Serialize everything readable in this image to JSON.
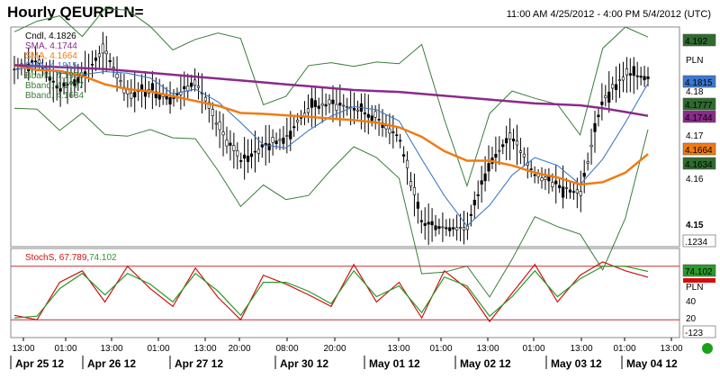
{
  "header": {
    "title": "Hourly QEURPLN=",
    "date_range": "11:00 AM 4/25/2012 - 4:00 PM 5/4/2012 (UTC)"
  },
  "chart_data": [
    {
      "type": "line",
      "name": "price_panel",
      "currency": "PLN",
      "x": [
        "04-25 09:00",
        "04-25 16:00",
        "04-26 00:00",
        "04-26 06:00",
        "04-26 12:00",
        "04-26 18:00",
        "04-27 00:00",
        "04-27 06:00",
        "04-27 12:00",
        "04-27 18:00",
        "04-29 21:00",
        "04-30 00:00",
        "04-30 06:00",
        "04-30 12:00",
        "04-30 18:00",
        "05-01 00:00",
        "05-01 06:00",
        "05-01 12:00",
        "05-01 18:00",
        "05-02 00:00",
        "05-02 06:00",
        "05-02 12:00",
        "05-02 18:00",
        "05-03 00:00",
        "05-03 06:00",
        "05-03 12:00",
        "05-03 18:00",
        "05-04 00:00",
        "05-04 06:00"
      ],
      "close": [
        4.184,
        4.186,
        4.18,
        4.183,
        4.188,
        4.179,
        4.18,
        4.178,
        4.182,
        4.172,
        4.165,
        4.168,
        4.17,
        4.176,
        4.177,
        4.176,
        4.174,
        4.17,
        4.152,
        4.151,
        4.151,
        4.165,
        4.17,
        4.162,
        4.16,
        4.158,
        4.178,
        4.183,
        4.1826
      ],
      "series": [
        {
          "name": "Cndl",
          "value": "4.1826",
          "color": "#000000"
        },
        {
          "name": "SMA",
          "value": "4.1744",
          "color": "#8b2a8b",
          "values": [
            4.185,
            4.1848,
            4.1846,
            4.1844,
            4.1842,
            4.1838,
            4.1834,
            4.183,
            4.1826,
            4.1822,
            4.1818,
            4.1814,
            4.181,
            4.1806,
            4.1802,
            4.1798,
            4.1796,
            4.1794,
            4.179,
            4.1786,
            4.1782,
            4.1778,
            4.1774,
            4.177,
            4.1768,
            4.1766,
            4.176,
            4.1752,
            4.1744
          ]
        },
        {
          "name": "SMA",
          "value": "4.1664",
          "color": "#f07b10",
          "values": [
            4.185,
            4.184,
            4.1838,
            4.1828,
            4.181,
            4.18,
            4.1795,
            4.1785,
            4.1775,
            4.1765,
            4.175,
            4.1748,
            4.1745,
            4.1742,
            4.1738,
            4.1735,
            4.173,
            4.172,
            4.17,
            4.167,
            4.165,
            4.165,
            4.164,
            4.1625,
            4.1615,
            4.16,
            4.1605,
            4.1625,
            4.1664
          ]
        },
        {
          "name": "SMA",
          "value": "4.1815",
          "color": "#3c78d0"
        },
        {
          "name": "Bband",
          "value": "4.1920",
          "color": "#3a7d3a"
        },
        {
          "name": "Bband",
          "value": "4.1777",
          "color": "#3a7d3a"
        },
        {
          "name": "Bband",
          "value": "4.1634",
          "color": "#3a7d3a"
        }
      ],
      "y_ticks": [
        "4.18",
        "4.17",
        "4.16",
        "4.15"
      ],
      "ylim": [
        4.147,
        4.193
      ],
      "tags": [
        {
          "label": "4.192",
          "color": "#2f6b2f"
        },
        {
          "label": "4.1815",
          "color": "#3c78d0"
        },
        {
          "label": "4.1777",
          "color": "#2f6b2f"
        },
        {
          "label": "4.1744",
          "color": "#8b2a8b"
        },
        {
          "label": "4.1664",
          "color": "#f07b10"
        },
        {
          "label": "4.1634",
          "color": "#2f6b2f"
        },
        {
          "label": ".1234",
          "color": "#ffffff"
        }
      ]
    },
    {
      "type": "line",
      "name": "stoch_panel",
      "currency": "PLN",
      "series": [
        {
          "name": "StochS",
          "value": "67.789",
          "color": "#d01010",
          "values": [
            25,
            20,
            62,
            75,
            40,
            80,
            55,
            35,
            78,
            45,
            20,
            70,
            60,
            48,
            35,
            82,
            40,
            62,
            22,
            75,
            55,
            18,
            50,
            82,
            40,
            70,
            85,
            75,
            67.789
          ]
        },
        {
          "name": "",
          "value": "74.102",
          "color": "#2a9a2a",
          "values": [
            22,
            24,
            55,
            72,
            48,
            72,
            60,
            40,
            72,
            52,
            25,
            62,
            62,
            52,
            38,
            75,
            46,
            58,
            28,
            68,
            58,
            24,
            46,
            75,
            46,
            66,
            80,
            80,
            74.102
          ]
        }
      ],
      "y_ticks": [
        "40",
        "20"
      ],
      "ylim": [
        0,
        100
      ],
      "ref_lines": [
        80,
        20
      ],
      "tags": [
        {
          "label": "74.102",
          "color": "#2a9a2a"
        },
        {
          "label": "-123",
          "color": "#ffffff"
        }
      ]
    }
  ],
  "x_axis": {
    "times": [
      "13:00",
      "01:00",
      "13:00",
      "01:00",
      "13:00",
      "20:00",
      "08:00",
      "20:00",
      "13:00",
      "01:00",
      "13:00",
      "01:00",
      "13:00",
      "01:00",
      "13:00"
    ],
    "dates": [
      "Apr 25 12",
      "Apr 26 12",
      "Apr 27 12",
      "Apr 30 12",
      "May 01 12",
      "May 02 12",
      "May 03 12",
      "May 04 12"
    ]
  },
  "status_dot_color": "#1aa01a"
}
